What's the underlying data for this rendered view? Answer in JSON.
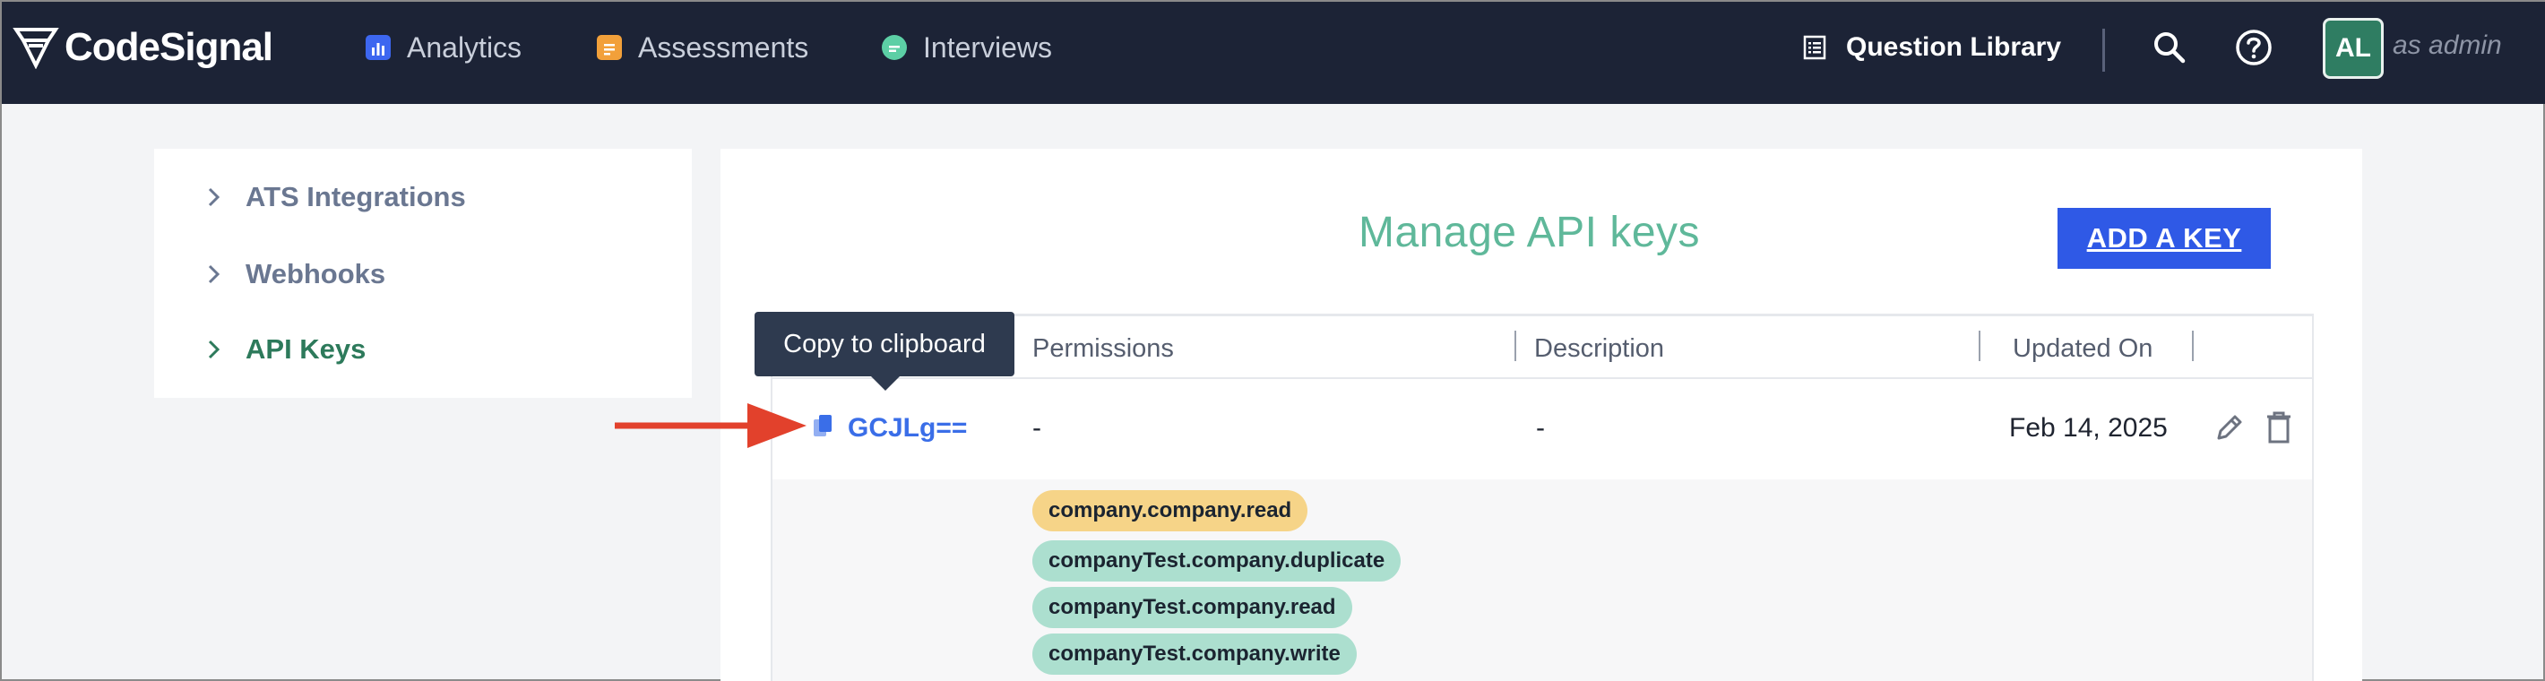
{
  "app": {
    "brand": "CodeSignal",
    "accent": "#2f59e6",
    "nav_bg": "#1c2336"
  },
  "nav": {
    "analytics": "Analytics",
    "assessments": "Assessments",
    "interviews": "Interviews",
    "question_library": "Question Library",
    "avatar_initials": "AL",
    "as_admin": "as admin"
  },
  "sidebar": {
    "items": [
      {
        "label": "ATS Integrations",
        "active": false
      },
      {
        "label": "Webhooks",
        "active": false
      },
      {
        "label": "API Keys",
        "active": true
      }
    ]
  },
  "main": {
    "title": "Manage API keys",
    "add_button": "ADD A KEY",
    "tooltip": "Copy to clipboard",
    "table": {
      "columns": [
        "Permissions",
        "Description",
        "Updated On"
      ],
      "row": {
        "key": "GCJLg==",
        "permissions": "-",
        "description": "-",
        "updated_on": "Feb 14, 2025"
      },
      "permissions_chips": [
        {
          "label": "company.company.read",
          "color": "#f6d488"
        },
        {
          "label": "companyTest.company.duplicate",
          "color": "#acdfcf"
        },
        {
          "label": "companyTest.company.read",
          "color": "#acdfcf"
        },
        {
          "label": "companyTest.company.write",
          "color": "#acdfcf"
        }
      ]
    }
  },
  "annotation": {
    "arrow_color": "#e2412c"
  }
}
